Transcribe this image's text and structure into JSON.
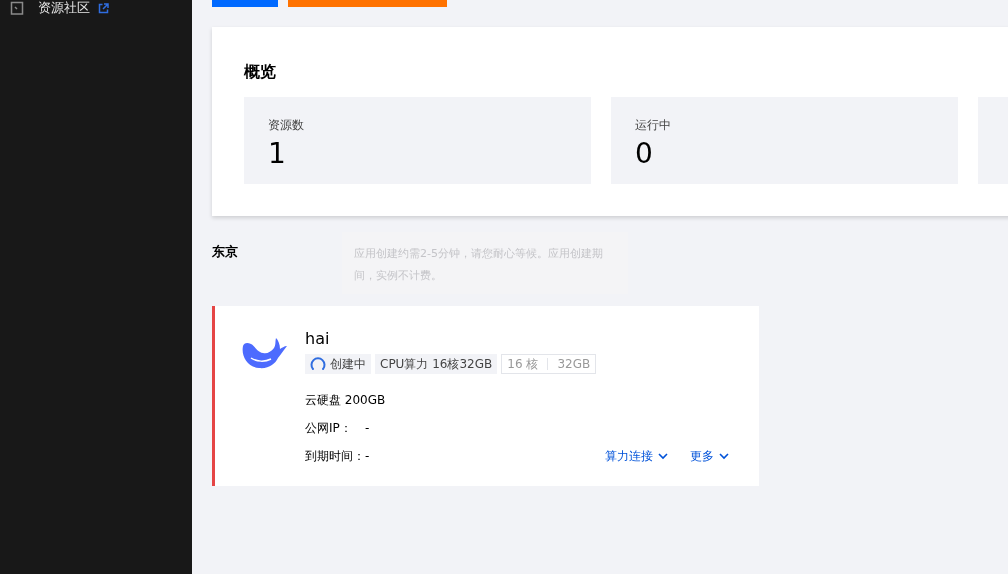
{
  "sidebar": {
    "items": [
      {
        "label": "资源社区",
        "external": true
      }
    ]
  },
  "toolbar": {
    "buttons": [
      {
        "kind": "primary"
      },
      {
        "kind": "warning"
      }
    ]
  },
  "overview": {
    "title": "概览",
    "stats": [
      {
        "label": "资源数",
        "value": "1"
      },
      {
        "label": "运行中",
        "value": "0"
      }
    ]
  },
  "tooltip": {
    "text": "应用创建约需2-5分钟，请您耐心等候。应用创建期间，实例不计费。"
  },
  "region": {
    "title": "东京"
  },
  "instances": [
    {
      "name": "hai",
      "status": "创建中",
      "loading": true,
      "spec": "CPU算力 16核32GB",
      "cores": "16 核",
      "memory": "32GB",
      "disk": "云硬盘 200GB",
      "ip_label": "公网IP：",
      "ip": "-",
      "expire_label": "到期时间：",
      "expire": "-",
      "actions": [
        "算力连接",
        "更多"
      ]
    }
  ]
}
